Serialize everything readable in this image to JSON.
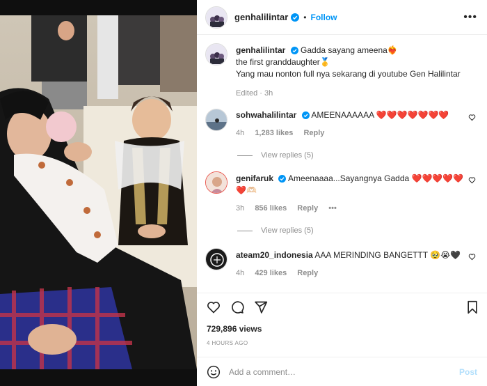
{
  "post": {
    "username": "genhalilintar",
    "follow_label": "Follow",
    "separator": "•",
    "more_icon": "more-horizontal-icon"
  },
  "caption": {
    "username": "genhalilintar",
    "line1": "Gadda sayang ameena",
    "line1_emoji": "❤️‍🔥",
    "line2": "the first granddaughter",
    "line2_emoji": "🥇",
    "line3": "Yang mau nonton full nya sekarang di youtube Gen Halilintar",
    "edited": "Edited · 3h"
  },
  "comments": [
    {
      "username": "sohwahalilintar",
      "text": "AMEENAAAAAA",
      "hearts": "❤️❤️❤️❤️❤️❤️❤️",
      "time": "4h",
      "likes": "1,283 likes",
      "reply": "Reply",
      "view_replies": "View replies (5)"
    },
    {
      "username": "genifaruk",
      "text": "Ameenaaaa...Sayangnya Gadda",
      "hearts": "❤️❤️❤️❤️❤️",
      "hearts2": "❤️🫶🏻",
      "time": "3h",
      "likes": "856 likes",
      "reply": "Reply",
      "more": "•••",
      "view_replies": "View replies (5)"
    },
    {
      "username": "ateam20_indonesia",
      "text": "AAA MERINDING BANGETTT",
      "emojis": "🥹😭🖤",
      "time": "4h",
      "likes": "429 likes",
      "reply": "Reply"
    }
  ],
  "stats": {
    "views": "729,896 views",
    "posted": "4 HOURS AGO"
  },
  "add_comment": {
    "placeholder": "Add a comment…",
    "post_label": "Post"
  },
  "colors": {
    "accent": "#0095f6",
    "muted": "#8e8e8e",
    "heart": "#ed1c24"
  }
}
